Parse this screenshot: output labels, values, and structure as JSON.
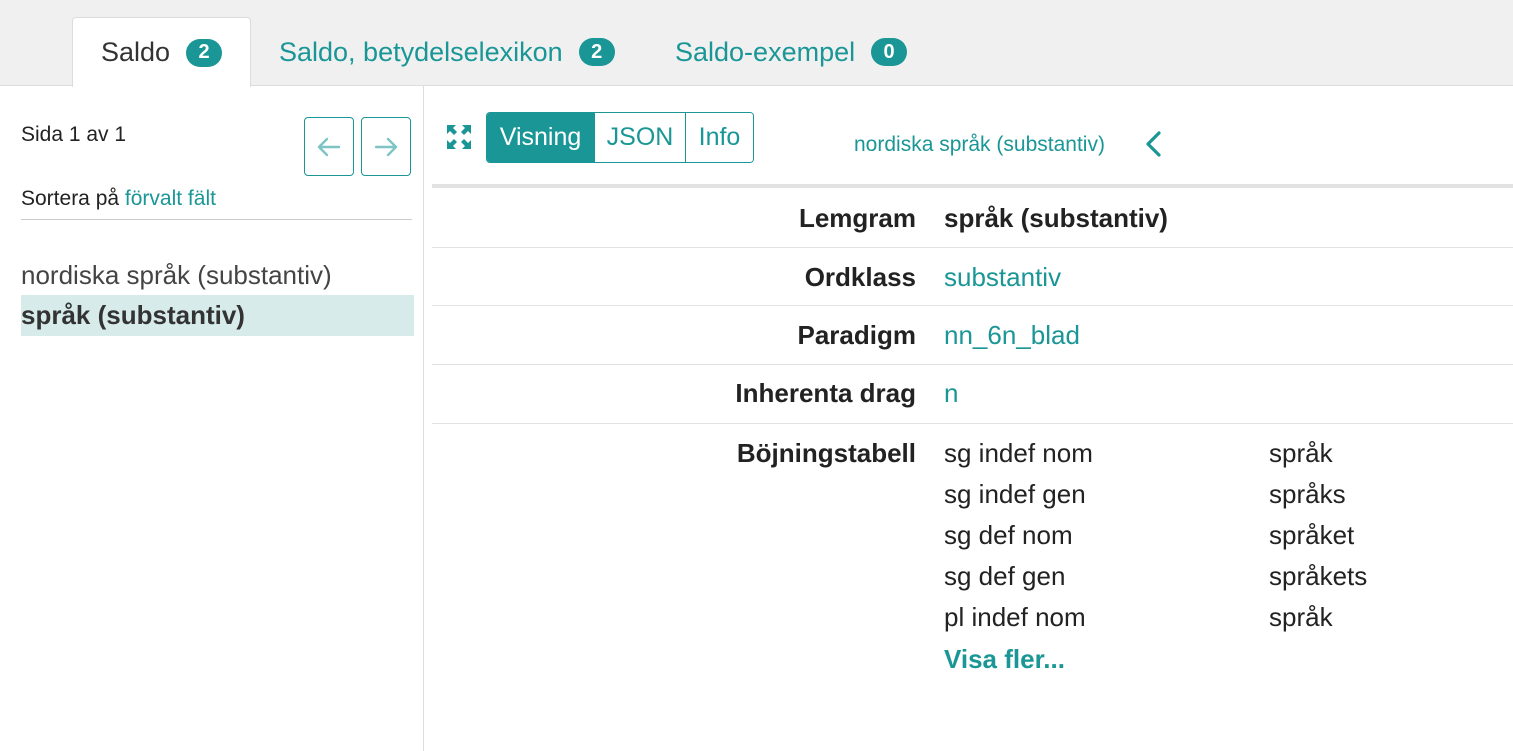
{
  "tabs": [
    {
      "label": "Saldo",
      "count": "2"
    },
    {
      "label": "Saldo, betydelselexikon",
      "count": "2"
    },
    {
      "label": "Saldo-exempel",
      "count": "0"
    }
  ],
  "sidebar": {
    "page_info": "Sida 1 av 1",
    "prev_icon": "arrow-left-icon",
    "next_icon": "arrow-right-icon",
    "sort_prefix": "Sortera på",
    "sort_link": "förvalt fält",
    "results": [
      {
        "label": "nordiska språk (substantiv)",
        "selected": false
      },
      {
        "label": "språk (substantiv)",
        "selected": true
      }
    ]
  },
  "entry": {
    "expand_icon": "expand-icon",
    "views": [
      "Visning",
      "JSON",
      "Info"
    ],
    "active_view": "Visning",
    "breadcrumb": "nordiska språk (substantiv)",
    "back_icon": "chevron-left-icon",
    "fields": {
      "lemgram": {
        "key": "Lemgram",
        "value": "språk (substantiv)"
      },
      "ordklass": {
        "key": "Ordklass",
        "value": "substantiv"
      },
      "paradigm": {
        "key": "Paradigm",
        "value": "nn_6n_blad"
      },
      "inherenta": {
        "key": "Inherenta drag",
        "value": "n"
      }
    },
    "inflection": {
      "key": "Böjningstabell",
      "rows": [
        {
          "form": "sg indef nom",
          "word": "språk"
        },
        {
          "form": "sg indef gen",
          "word": "språks"
        },
        {
          "form": "sg def nom",
          "word": "språket"
        },
        {
          "form": "sg def gen",
          "word": "språkets"
        },
        {
          "form": "pl indef nom",
          "word": "språk"
        }
      ],
      "more_label": "Visa fler..."
    }
  },
  "colors": {
    "accent": "#1a9696",
    "selected_bg": "#d6ebea",
    "tabbar_bg": "#f0f0f0"
  }
}
